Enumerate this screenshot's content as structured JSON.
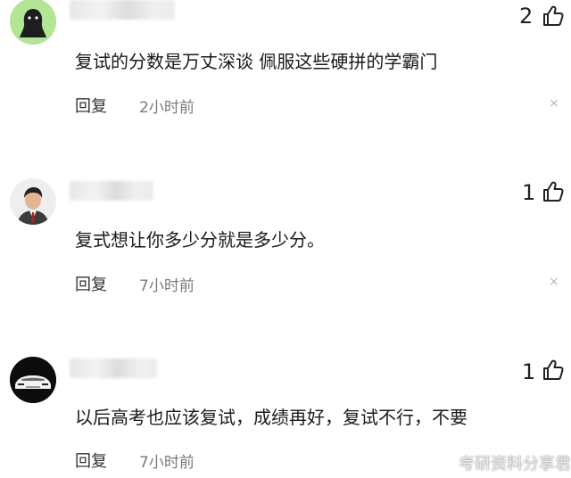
{
  "comments": [
    {
      "avatar": "dark-bird-silhouette-on-green",
      "likes": "2",
      "text": "复试的分数是万丈深谈 佩服这些硬拼的学霸门",
      "reply_label": "回复",
      "time": "2小时前"
    },
    {
      "avatar": "man-portrait",
      "likes": "1",
      "text": "复式想让你多少分就是多少分。",
      "reply_label": "回复",
      "time": "7小时前"
    },
    {
      "avatar": "car-on-black",
      "likes": "1",
      "text": "以后高考也应该复试，成绩再好，复试不行，不要",
      "reply_label": "回复",
      "time": "7小时前"
    }
  ],
  "watermark": "考研资料分享君",
  "icons": {
    "like": "thumb-up-icon",
    "close": "close-icon",
    "weibo": "weibo-logo-icon"
  }
}
